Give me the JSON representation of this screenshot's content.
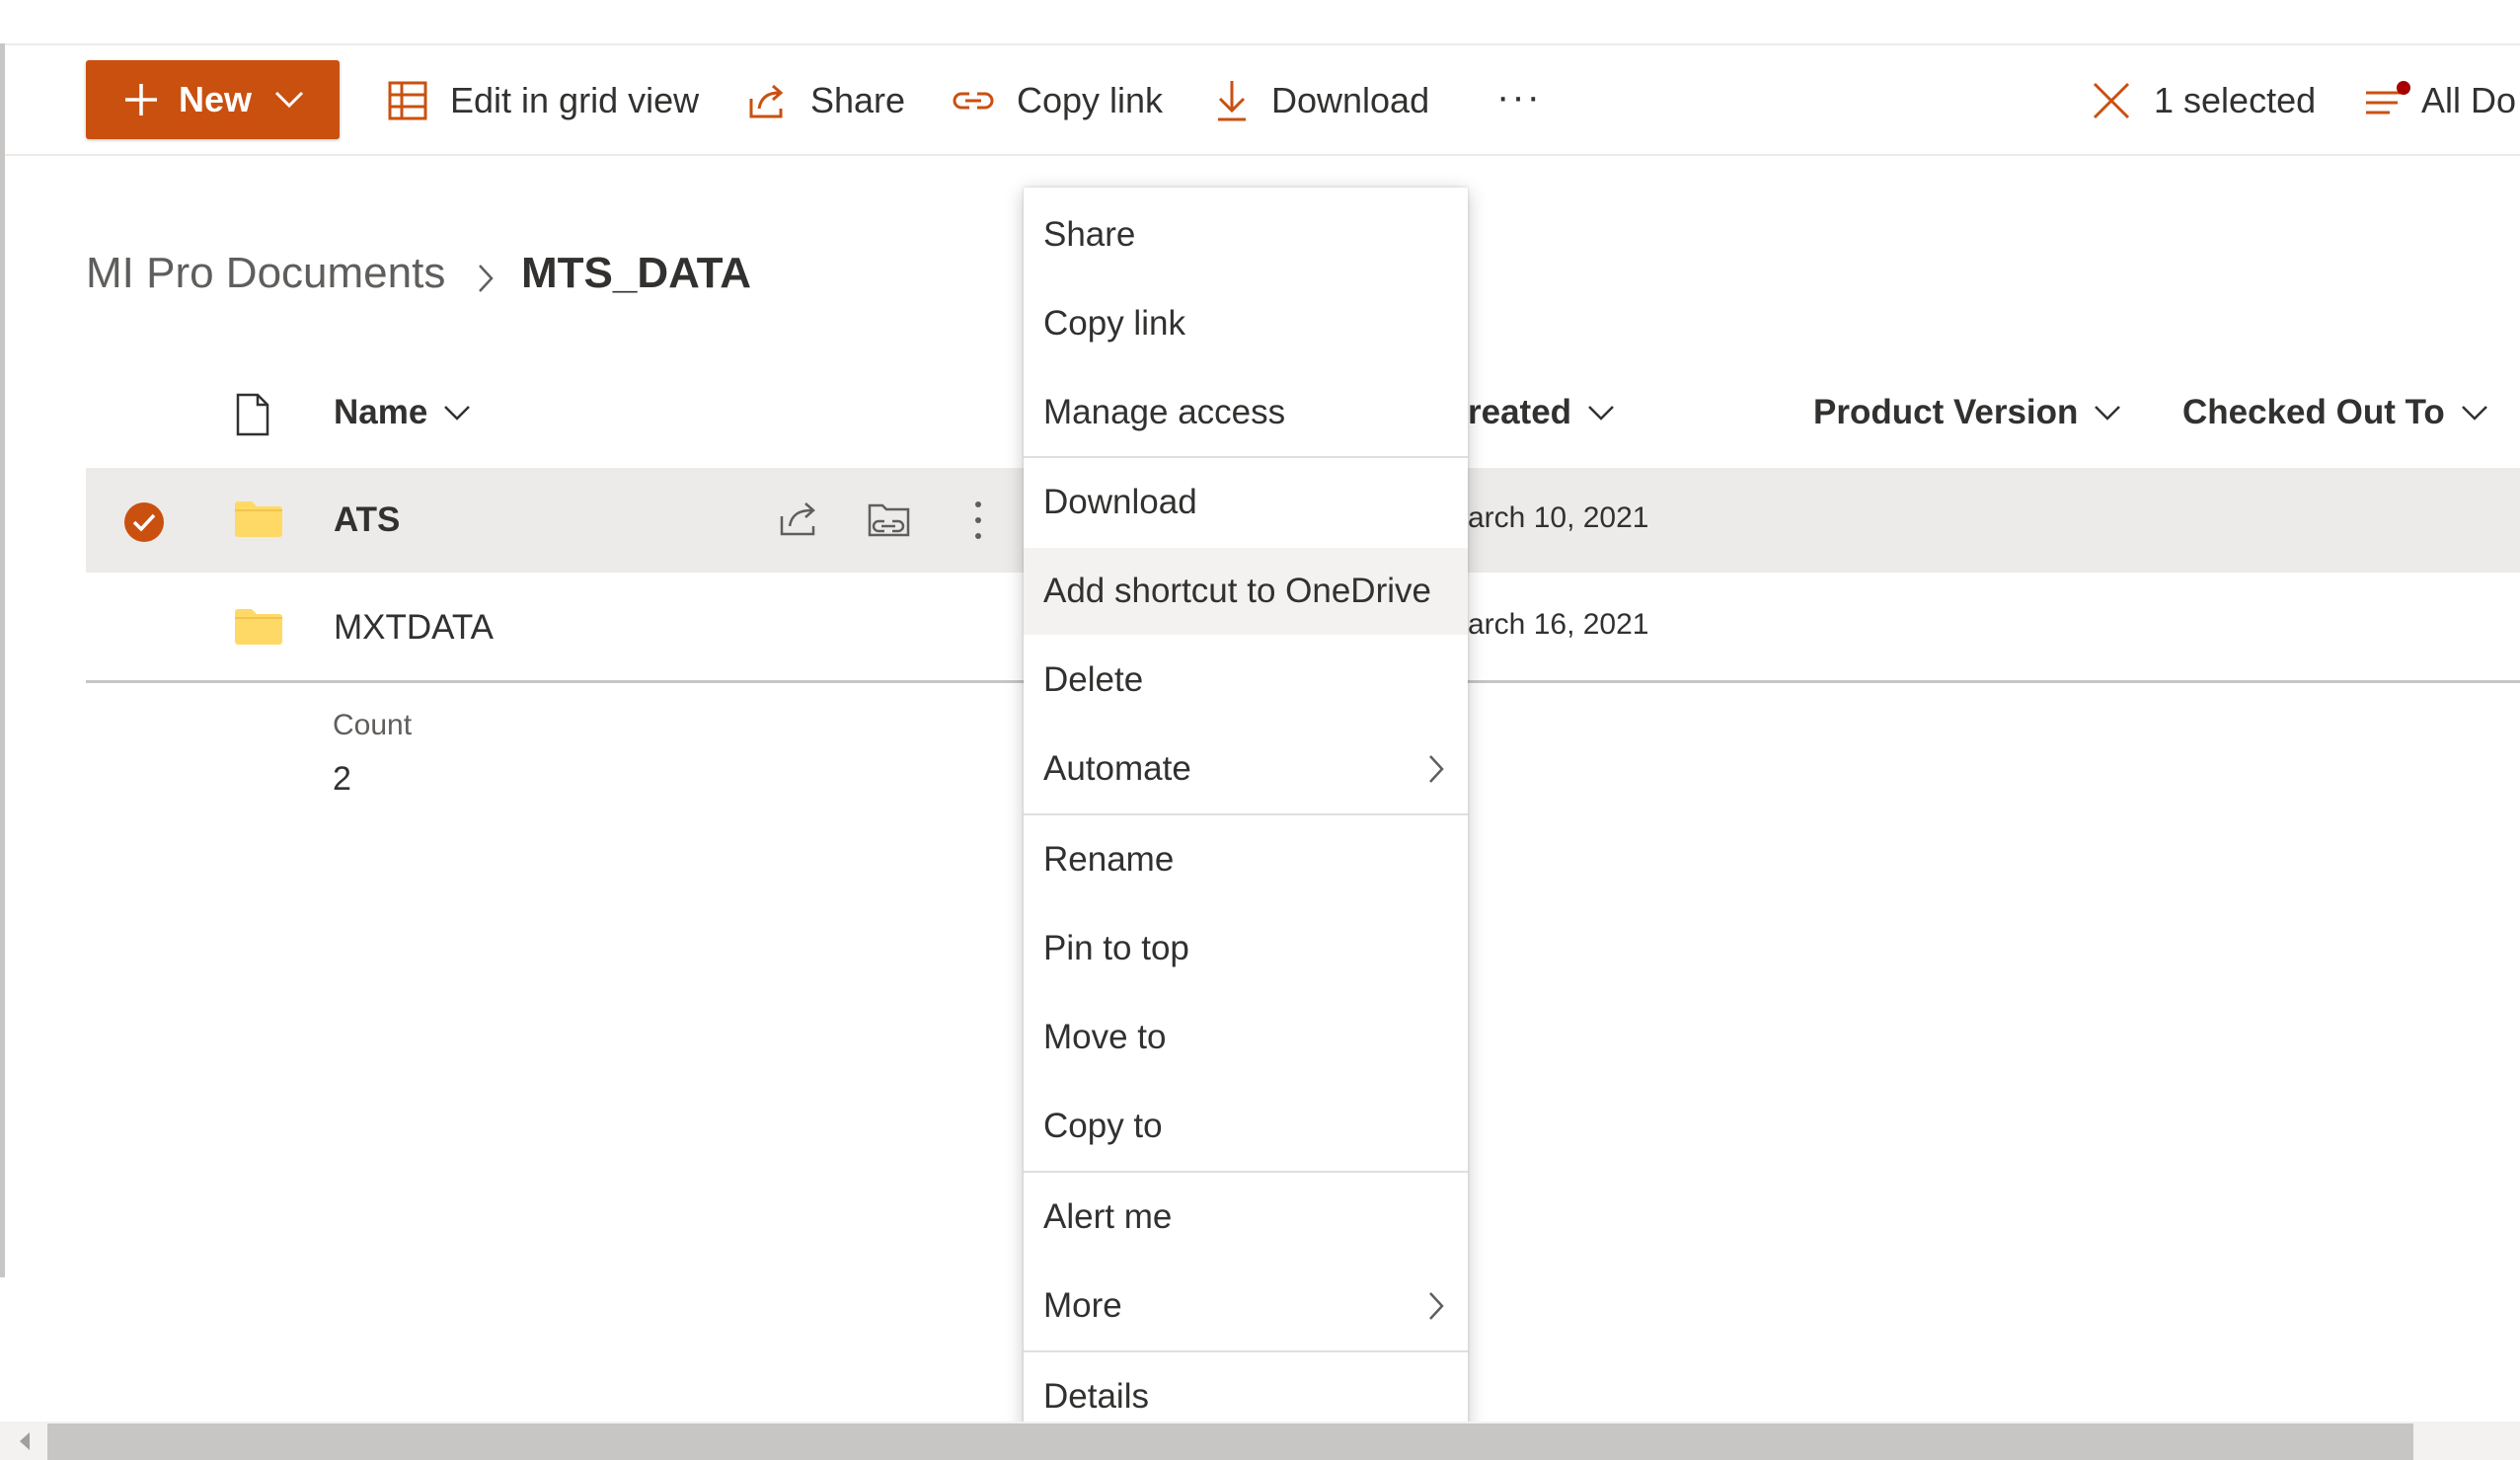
{
  "toolbar": {
    "new_label": "New",
    "edit_grid_label": "Edit in grid view",
    "share_label": "Share",
    "copy_link_label": "Copy link",
    "download_label": "Download",
    "more_label": "···",
    "selected_label": "1 selected",
    "view_label": "All Do"
  },
  "breadcrumb": {
    "parent": "MI Pro Documents",
    "current": "MTS_DATA"
  },
  "columns": {
    "name": "Name",
    "created": "reated",
    "product_version": "Product Version",
    "checked_out_to": "Checked Out To"
  },
  "rows": [
    {
      "name": "ATS",
      "created": "arch 10, 2021",
      "selected": true
    },
    {
      "name": "MXTDATA",
      "created": "arch 16, 2021",
      "selected": false
    }
  ],
  "footer": {
    "count_label": "Count",
    "count_value": "2"
  },
  "context_menu": {
    "items": [
      {
        "label": "Share"
      },
      {
        "label": "Copy link"
      },
      {
        "label": "Manage access"
      },
      {
        "label": "Download"
      },
      {
        "label": "Add shortcut to OneDrive",
        "highlighted": true
      },
      {
        "label": "Delete"
      },
      {
        "label": "Automate",
        "submenu": true
      },
      {
        "label": "Rename"
      },
      {
        "label": "Pin to top"
      },
      {
        "label": "Move to"
      },
      {
        "label": "Copy to"
      },
      {
        "label": "Alert me"
      },
      {
        "label": "More",
        "submenu": true
      },
      {
        "label": "Details"
      }
    ]
  },
  "colors": {
    "accent": "#ca5010",
    "folder": "#ffd966",
    "selected_row": "#edebe9",
    "notification_dot": "#a80000"
  }
}
